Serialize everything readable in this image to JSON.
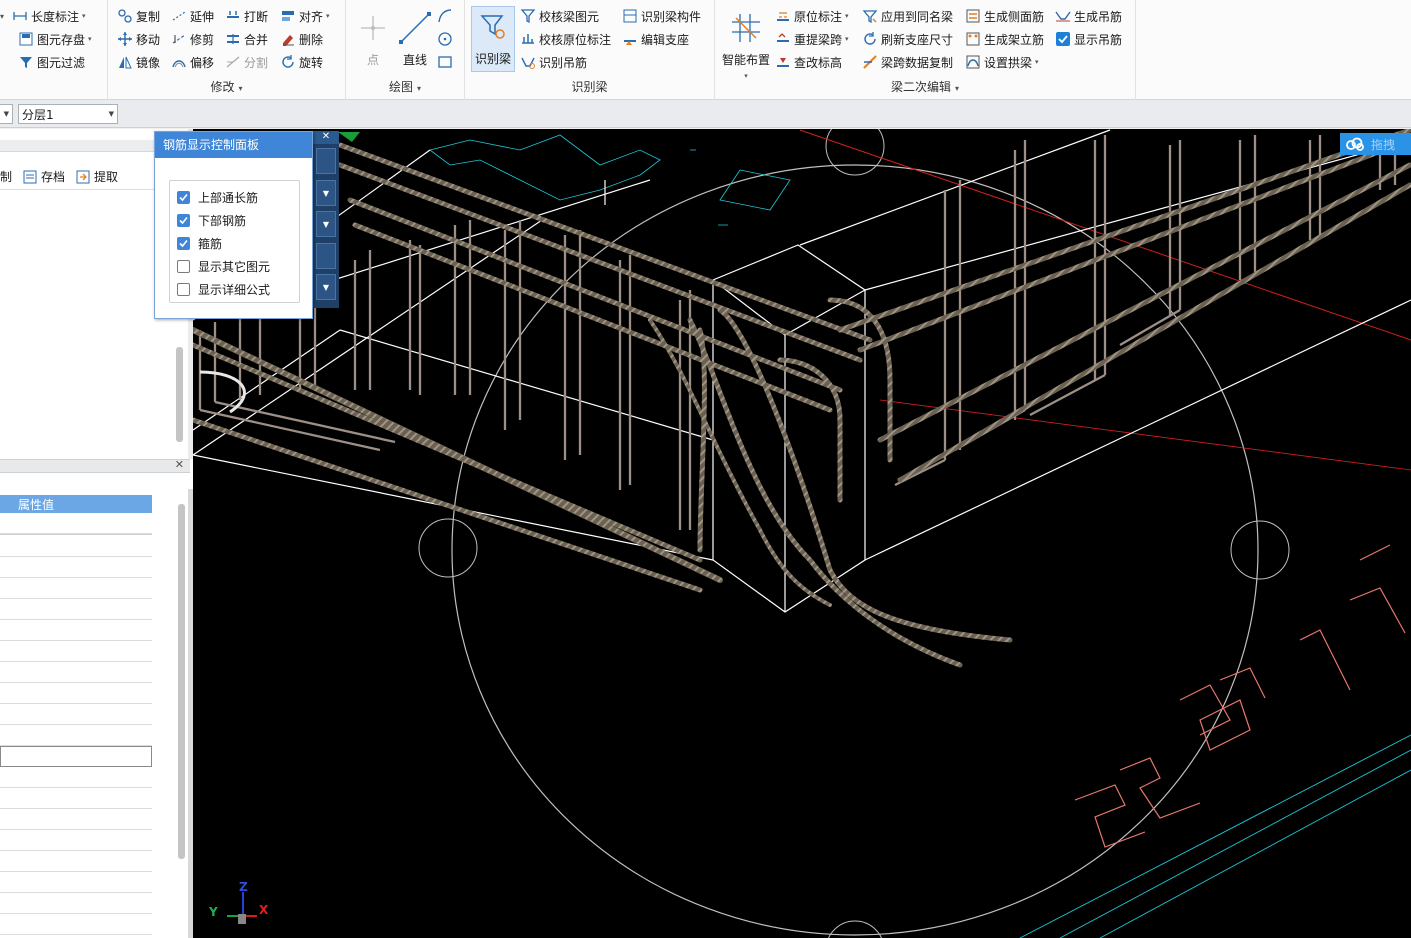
{
  "ribbon": {
    "group1": {
      "length_mark": "长度标注",
      "save_elements": "图元存盘",
      "filter_elements": "图元过滤"
    },
    "modify": {
      "title": "修改",
      "copy": "复制",
      "extend": "延伸",
      "break": "打断",
      "align": "对齐",
      "move": "移动",
      "trim": "修剪",
      "merge": "合并",
      "delete": "删除",
      "mirror": "镜像",
      "offset": "偏移",
      "split": "分割",
      "rotate": "旋转"
    },
    "draw": {
      "title": "绘图",
      "point": "点",
      "line": "直线"
    },
    "identify_beam": {
      "title": "识别梁",
      "identify_beam": "识别梁",
      "check_beam_elements": "校核梁图元",
      "check_in_situ_annotation": "校核原位标注",
      "identify_hanger": "识别吊筋",
      "identify_beam_component": "识别梁构件",
      "edit_support": "编辑支座"
    },
    "beam_secondary": {
      "title": "梁二次编辑",
      "smart_layout": "智能布置",
      "in_situ_annotation": "原位标注",
      "re_pick_span": "重提梁跨",
      "check_elevation": "查改标高",
      "apply_same_name": "应用到同名梁",
      "refresh_support_size": "刷新支座尺寸",
      "span_data_copy": "梁跨数据复制",
      "gen_side_rebar": "生成侧面筋",
      "gen_erection_rebar": "生成架立筋",
      "set_arch_beam": "设置拱梁",
      "gen_hanger": "生成吊筋",
      "show_hanger": "显示吊筋"
    }
  },
  "layerbar": {
    "layer": "分层1"
  },
  "left_panel": {
    "toolbar": {
      "cut_label": "制",
      "save_label": "存档",
      "extract_label": "提取"
    },
    "props": {
      "header": "属性值"
    }
  },
  "rebar_panel": {
    "title": "钢筋显示控制面板",
    "options": [
      {
        "label": "上部通长筋",
        "checked": true
      },
      {
        "label": "下部钢筋",
        "checked": true
      },
      {
        "label": "箍筋",
        "checked": true
      },
      {
        "label": "显示其它图元",
        "checked": false
      },
      {
        "label": "显示详细公式",
        "checked": false
      }
    ]
  },
  "drag_widget": {
    "label": "拖拽"
  },
  "axis": {
    "x": "X",
    "y": "Y",
    "z": "Z"
  }
}
